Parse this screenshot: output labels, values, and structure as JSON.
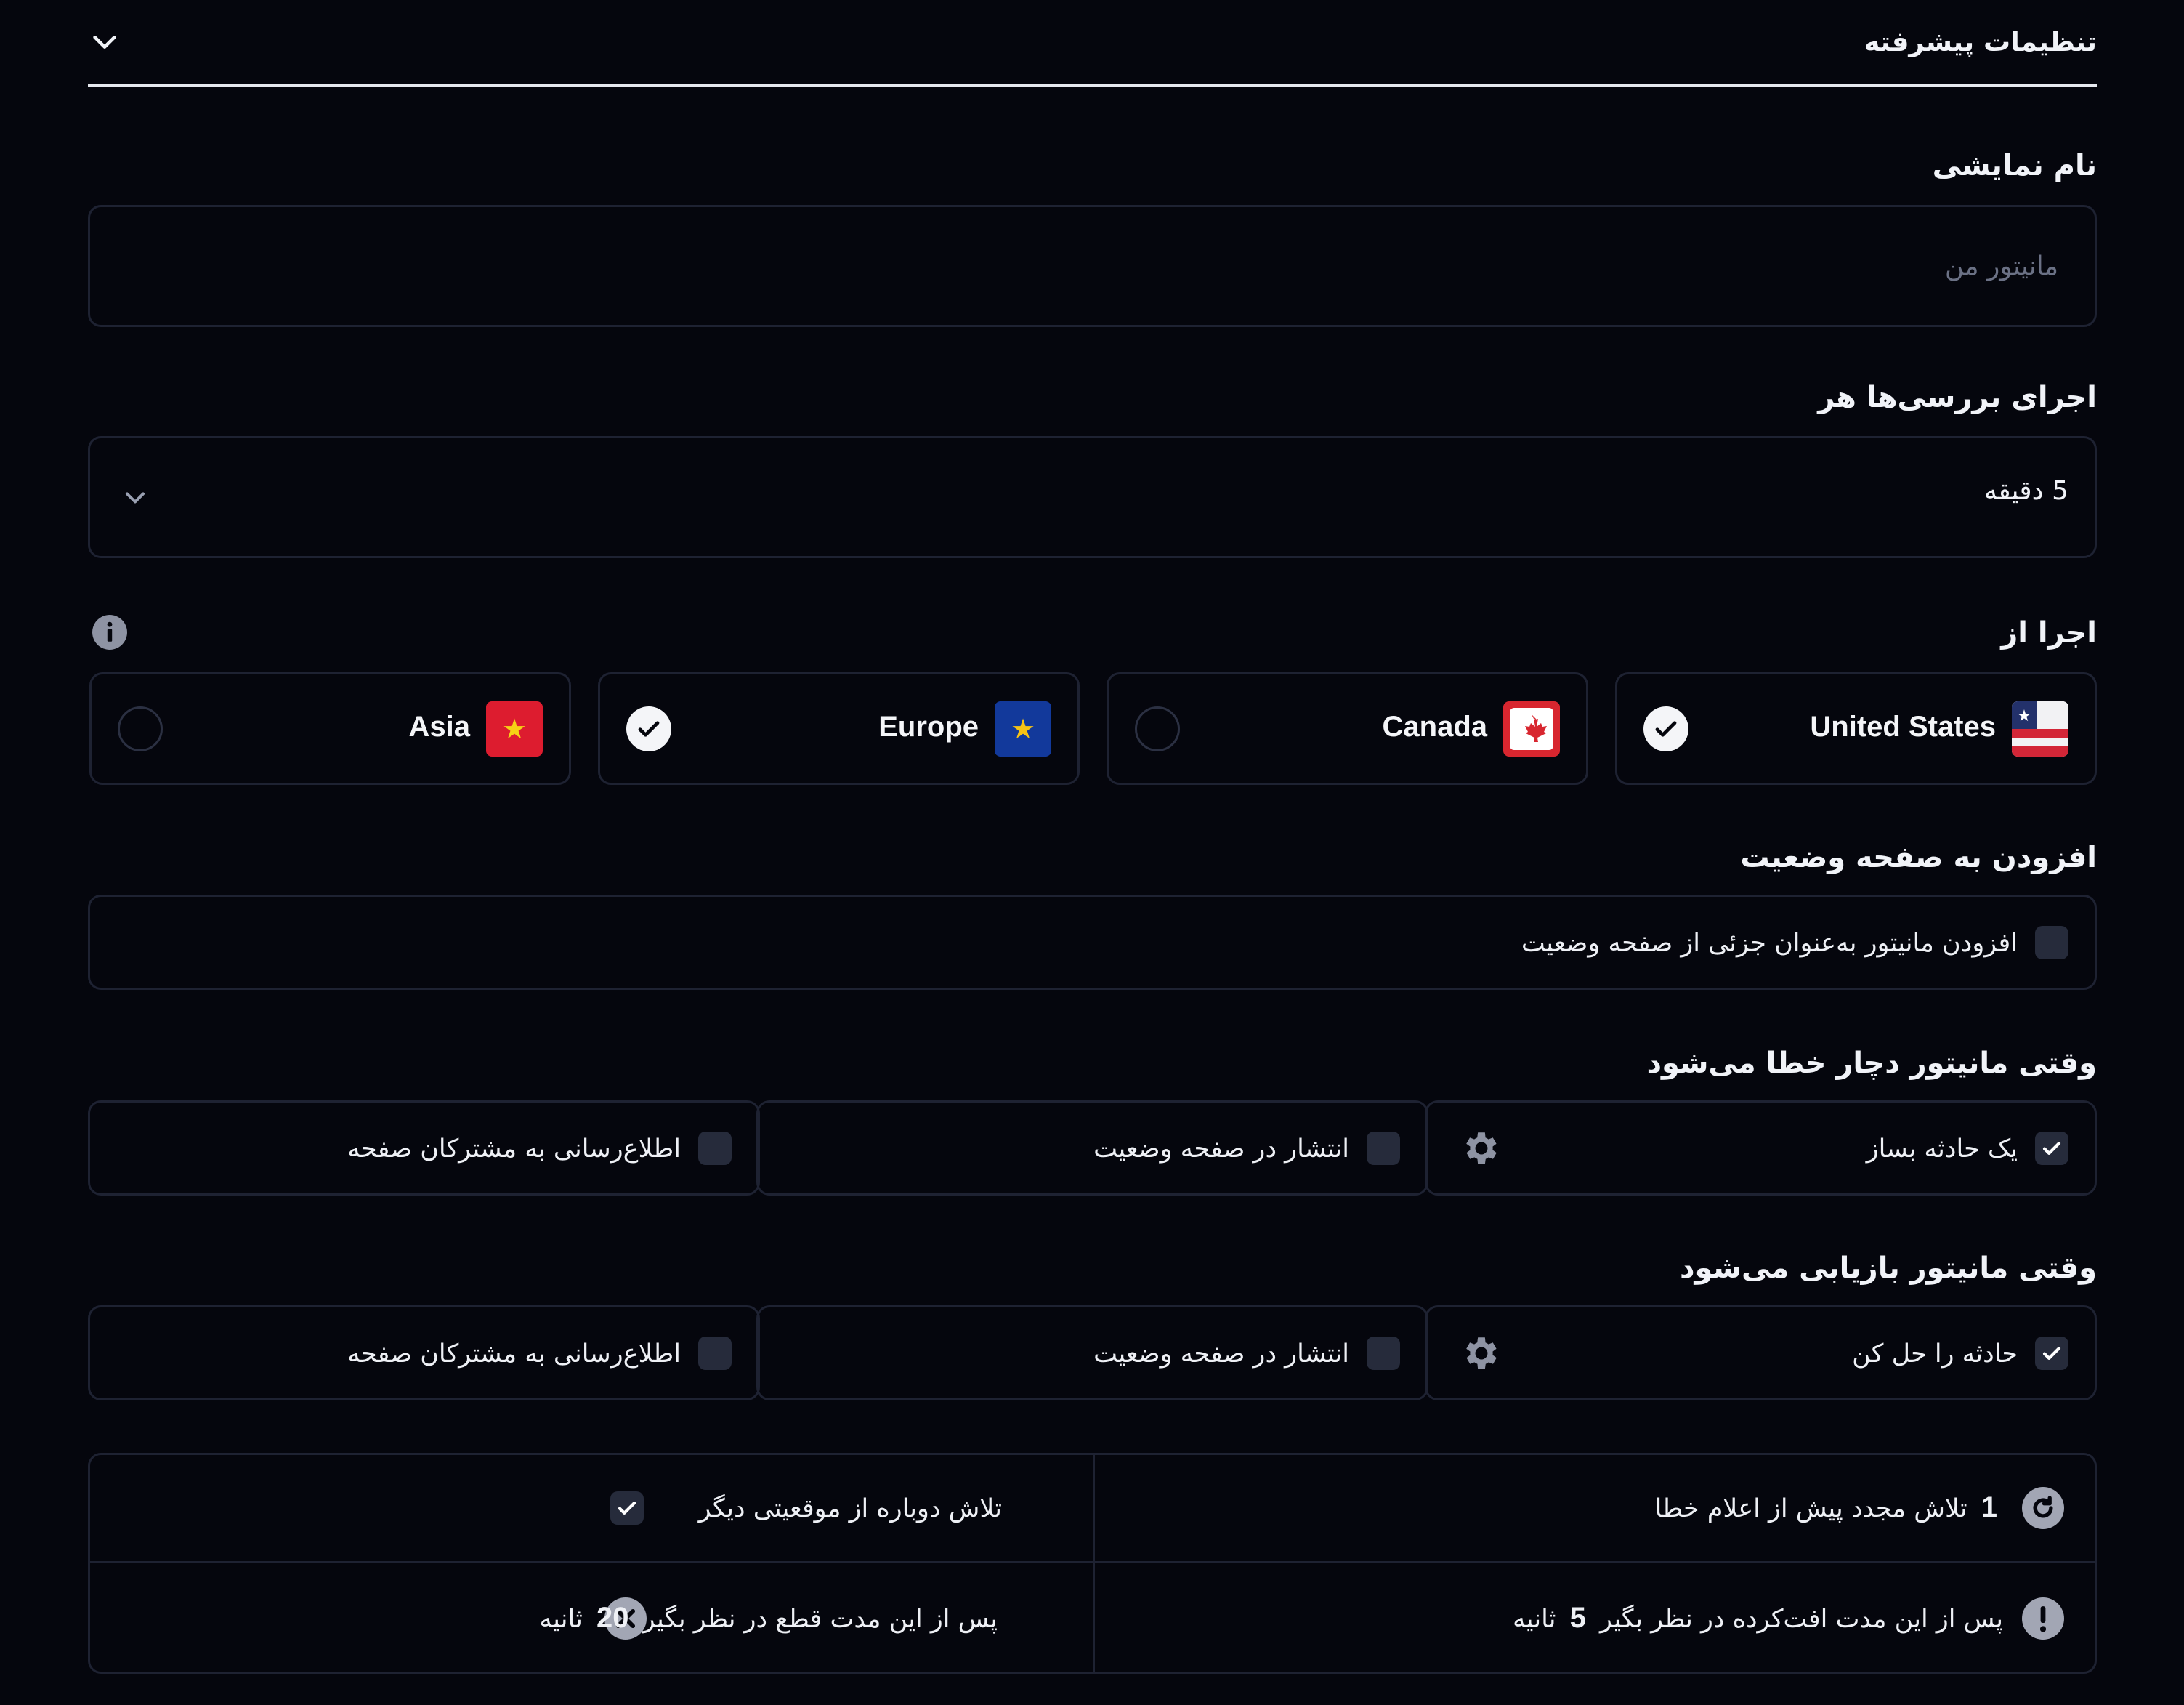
{
  "advanced": {
    "title": "تنظیمات پیشرفته"
  },
  "display_name": {
    "label": "نام نمایشی",
    "placeholder": "مانیتور من",
    "value": ""
  },
  "interval": {
    "label": "اجرای بررسی‌ها هر",
    "value": "5 دقیقه"
  },
  "regions": {
    "label": "اجرا از",
    "items": [
      {
        "name": "United States",
        "selected": true
      },
      {
        "name": "Canada",
        "selected": false
      },
      {
        "name": "Europe",
        "selected": true
      },
      {
        "name": "Asia",
        "selected": false
      }
    ]
  },
  "status_page": {
    "label": "افزودن به صفحه وضعیت",
    "option": "افزودن مانیتور به‌عنوان جزئی از صفحه وضعیت",
    "checked": false
  },
  "on_failure": {
    "label": "وقتی مانیتور دچار خطا می‌شود",
    "create_incident": "یک حادثه بساز",
    "publish": "انتشار در صفحه وضعیت",
    "notify": "اطلاع‌رسانی به مشترکان صفحه"
  },
  "on_recovery": {
    "label": "وقتی مانیتور بازیابی می‌شود",
    "resolve": "حادثه را حل کن",
    "publish": "انتشار در صفحه وضعیت",
    "notify": "اطلاع‌رسانی به مشترکان صفحه"
  },
  "advanced_options": {
    "retries_count": "1",
    "retries_text": "تلاش مجدد پیش از اعلام خطا",
    "retry_other_location": "تلاش دوباره از موقعیتی دیگر",
    "degraded_prefix": "پس از این مدت افت‌کرده در نظر بگیر",
    "degraded_value": "5",
    "degraded_unit": "ثانیه",
    "timeout_prefix": "پس از این مدت قطع در نظر بگیر",
    "timeout_value": "20",
    "timeout_unit": "ثانیه"
  },
  "colors": {
    "background": "#05060d",
    "border": "#1e2232",
    "checkbox": "#262b3b",
    "text": "#f1f3f8",
    "muted": "#6b7185"
  }
}
